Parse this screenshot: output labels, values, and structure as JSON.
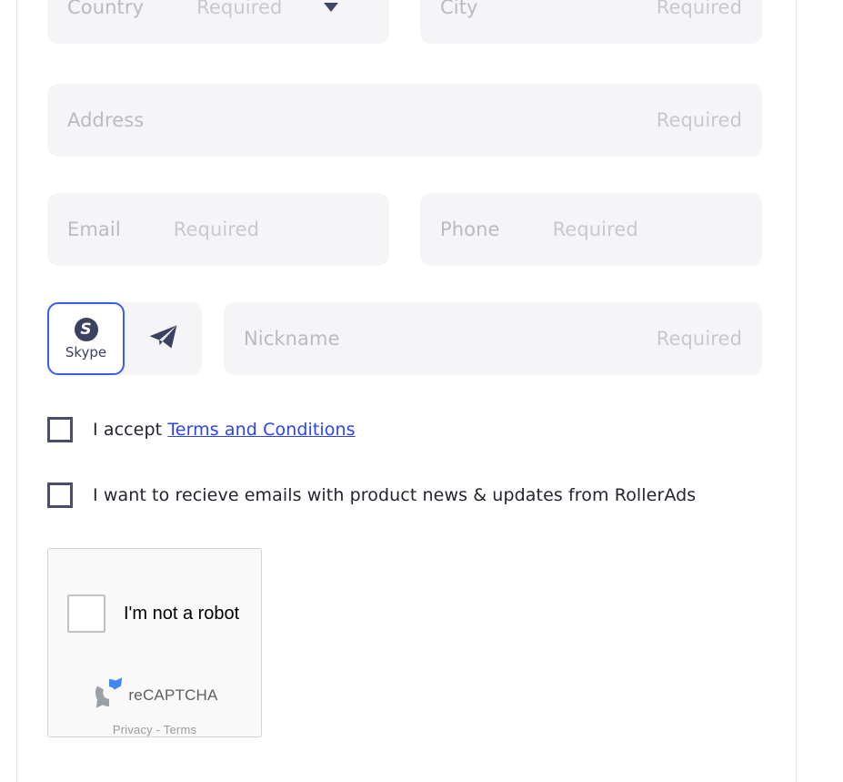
{
  "form": {
    "fields": [
      {
        "name": "country",
        "placeholder": "Country",
        "required_label": "Required",
        "has_caret": true
      },
      {
        "name": "city",
        "placeholder": "City",
        "required_label": "Required"
      },
      {
        "name": "address",
        "placeholder": "Address",
        "required_label": "Required"
      },
      {
        "name": "email",
        "placeholder": "Email",
        "required_label": "Required"
      },
      {
        "name": "phone",
        "placeholder": "Phone",
        "required_label": "Required"
      },
      {
        "name": "nickname",
        "placeholder": "Nickname",
        "required_label": "Required"
      }
    ],
    "country": {
      "placeholder": "Country",
      "required_label": "Required"
    },
    "city": {
      "placeholder": "City",
      "required_label": "Required"
    },
    "address": {
      "placeholder": "Address",
      "required_label": "Required"
    },
    "email": {
      "placeholder": "Email",
      "required_label": "Required"
    },
    "phone": {
      "placeholder": "Phone",
      "required_label": "Required"
    },
    "nickname": {
      "placeholder": "Nickname",
      "required_label": "Required"
    }
  },
  "messenger": {
    "options": [
      {
        "id": "skype",
        "label": "Skype",
        "icon": "skype-icon",
        "selected": true
      },
      {
        "id": "telegram",
        "label": "",
        "icon": "telegram-icon",
        "selected": false
      }
    ],
    "skype": {
      "label": "Skype",
      "glyph": "S"
    },
    "telegram": {
      "label": ""
    }
  },
  "consents": [
    {
      "id": "terms",
      "checked": false,
      "text_before": "I accept ",
      "link_text": "Terms and Conditions",
      "text_after": ""
    },
    {
      "id": "newsletter",
      "checked": false,
      "text_before": "I want to recieve emails with product news & updates from RollerAds",
      "link_text": "",
      "text_after": ""
    }
  ],
  "consent_terms": {
    "prefix": "I accept ",
    "link": "Terms and Conditions"
  },
  "consent_news": {
    "text": "I want to recieve emails with product news & updates from RollerAds"
  },
  "recaptcha": {
    "checkbox_checked": false,
    "label": "I'm not a robot",
    "brand": "reCAPTCHA",
    "privacy": "Privacy",
    "separator": " - ",
    "terms": "Terms",
    "links_text": "Privacy - Terms"
  },
  "colors": {
    "field_bg": "#f5f5f7",
    "placeholder": "#b9bac4",
    "required": "#c7c8d1",
    "accent_blue": "#3a5cf0",
    "link_blue": "#2b44f0",
    "dark_navy": "#3b4160",
    "recaptcha_bg": "#f9f9f9",
    "recaptcha_border": "#d3d3d3"
  }
}
